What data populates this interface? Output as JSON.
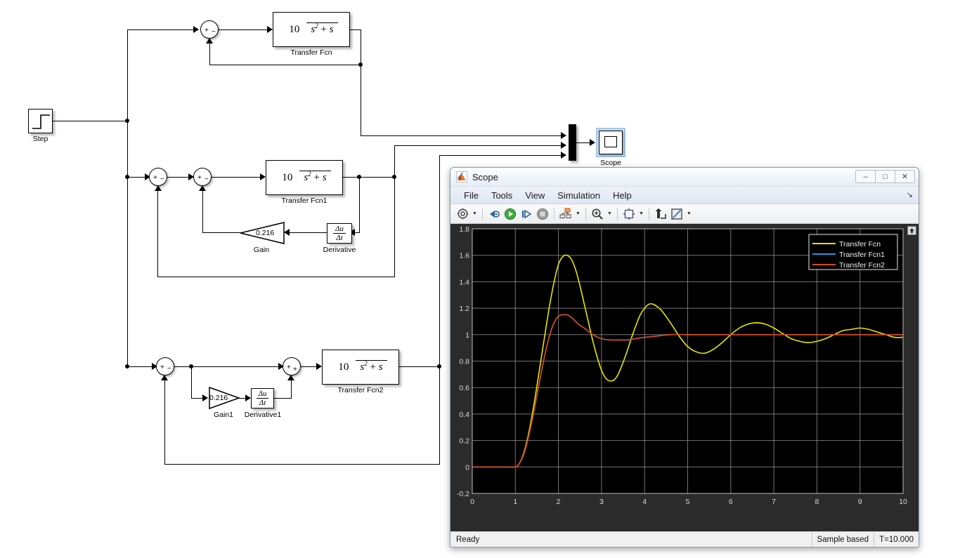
{
  "diagram": {
    "blocks": [
      {
        "id": "step",
        "type": "step",
        "label": "Step"
      },
      {
        "id": "sum_top",
        "type": "sum",
        "label": "",
        "signs": [
          "+",
          "-"
        ]
      },
      {
        "id": "tf0",
        "type": "transferfcn",
        "label": "Transfer Fcn",
        "numerator": "10",
        "denominator": "s^2 + s"
      },
      {
        "id": "sum_mid_a",
        "type": "sum",
        "label": "",
        "signs": [
          "+",
          "-"
        ]
      },
      {
        "id": "sum_mid_b",
        "type": "sum",
        "label": "",
        "signs": [
          "+",
          "-"
        ]
      },
      {
        "id": "tf1",
        "type": "transferfcn",
        "label": "Transfer Fcn1",
        "numerator": "10",
        "denominator": "s^2 + s"
      },
      {
        "id": "gain",
        "type": "gain",
        "label": "Gain",
        "value": "0.216"
      },
      {
        "id": "deriv",
        "type": "derivative",
        "label": "Derivative",
        "expr": "du/dt"
      },
      {
        "id": "sum_bot_a",
        "type": "sum",
        "label": "",
        "signs": [
          "+",
          "-"
        ]
      },
      {
        "id": "gain1",
        "type": "gain",
        "label": "Gain1",
        "value": "0.216"
      },
      {
        "id": "deriv1",
        "type": "derivative",
        "label": "Derivative1",
        "expr": "du/dt"
      },
      {
        "id": "sum_bot_b",
        "type": "sum",
        "label": "",
        "signs": [
          "+",
          "+"
        ]
      },
      {
        "id": "tf2",
        "type": "transferfcn",
        "label": "Transfer Fcn2",
        "numerator": "10",
        "denominator": "s^2 + s"
      },
      {
        "id": "mux",
        "type": "mux",
        "label": "",
        "inputs": 3
      },
      {
        "id": "scope",
        "type": "scope",
        "label": "Scope",
        "selected": true
      }
    ],
    "labels": {
      "step": "Step",
      "tf0": "Transfer Fcn",
      "tf1": "Transfer Fcn1",
      "tf2": "Transfer Fcn2",
      "gain": "Gain",
      "gain1": "Gain1",
      "deriv": "Derivative",
      "deriv1": "Derivative1",
      "scope": "Scope"
    },
    "values": {
      "gain": "0.216",
      "gain1": "0.216",
      "tf_num": "10",
      "tf_den_base": "s",
      "tf_den_exp": "2",
      "tf_den_tail": "+ s",
      "deriv_num": "Δu",
      "deriv_den": "Δt"
    }
  },
  "scope_window": {
    "title": "Scope",
    "icon": "matlab-icon",
    "window_buttons": [
      {
        "name": "minimize-button",
        "glyph": "–"
      },
      {
        "name": "maximize-button",
        "glyph": "□"
      },
      {
        "name": "close-button",
        "glyph": "✕"
      }
    ],
    "menu": [
      "File",
      "Tools",
      "View",
      "Simulation",
      "Help"
    ],
    "undock_glyph": "↘",
    "toolbar": [
      {
        "name": "configuration-properties-icon",
        "has_caret": true
      },
      {
        "name": "separator"
      },
      {
        "name": "run-back-to-start-icon",
        "has_caret": false
      },
      {
        "name": "run-icon",
        "has_caret": false
      },
      {
        "name": "step-forward-icon",
        "has_caret": false
      },
      {
        "name": "stop-icon",
        "has_caret": false
      },
      {
        "name": "separator"
      },
      {
        "name": "signal-selection-icon",
        "has_caret": true
      },
      {
        "name": "separator"
      },
      {
        "name": "zoom-in-icon",
        "has_caret": true
      },
      {
        "name": "separator"
      },
      {
        "name": "autoscale-icon",
        "has_caret": true
      },
      {
        "name": "separator"
      },
      {
        "name": "cursor-measurements-icon",
        "has_caret": false
      },
      {
        "name": "measurements-icon",
        "has_caret": true
      }
    ],
    "plot_overlay_button": {
      "name": "maximize-axes-button",
      "glyph": "⬆"
    },
    "statusbar": {
      "status": "Ready",
      "frame_mode": "Sample based",
      "time": "T=10.000"
    }
  },
  "chart_data": {
    "type": "line",
    "title": "",
    "xlabel": "",
    "ylabel": "",
    "xlim": [
      0,
      10
    ],
    "ylim": [
      -0.2,
      1.8
    ],
    "xticks": [
      0,
      1,
      2,
      3,
      4,
      5,
      6,
      7,
      8,
      9,
      10
    ],
    "yticks": [
      -0.2,
      0,
      0.2,
      0.4,
      0.6,
      0.8,
      1,
      1.2,
      1.4,
      1.6,
      1.8
    ],
    "xtick_labels": [
      "0",
      "1",
      "2",
      "3",
      "4",
      "5",
      "6",
      "7",
      "8",
      "9",
      "10"
    ],
    "ytick_labels": [
      "-0.2",
      "0",
      "0.2",
      "0.4",
      "0.6",
      "0.8",
      "1",
      "1.2",
      "1.4",
      "1.6",
      "1.8"
    ],
    "grid": true,
    "background": "#000000",
    "grid_color": "#9a9a9a",
    "legend_position": "top-right",
    "legend_background": "#000000",
    "series": [
      {
        "name": "Transfer Fcn",
        "color": "#e6e600",
        "x": [
          0,
          0.5,
          1,
          1.05,
          1.1,
          1.2,
          1.3,
          1.4,
          1.5,
          1.6,
          1.7,
          1.8,
          1.9,
          2.0,
          2.1,
          2.2,
          2.3,
          2.4,
          2.5,
          2.6,
          2.7,
          2.8,
          2.9,
          3.0,
          3.1,
          3.2,
          3.3,
          3.4,
          3.5,
          3.6,
          3.7,
          3.8,
          3.9,
          4.0,
          4.1,
          4.2,
          4.3,
          4.4,
          4.6,
          4.8,
          5.0,
          5.2,
          5.4,
          5.6,
          5.8,
          6.0,
          6.2,
          6.4,
          6.6,
          6.8,
          7.0,
          7.2,
          7.4,
          7.6,
          7.8,
          8.0,
          8.2,
          8.4,
          8.6,
          8.8,
          9.0,
          9.2,
          9.4,
          9.6,
          9.8,
          10.0
        ],
        "y": [
          0,
          0,
          0,
          0.01,
          0.03,
          0.11,
          0.24,
          0.41,
          0.61,
          0.82,
          1.03,
          1.23,
          1.4,
          1.53,
          1.59,
          1.6,
          1.57,
          1.49,
          1.37,
          1.23,
          1.09,
          0.95,
          0.83,
          0.73,
          0.67,
          0.65,
          0.66,
          0.71,
          0.79,
          0.88,
          0.98,
          1.07,
          1.15,
          1.2,
          1.23,
          1.23,
          1.21,
          1.18,
          1.09,
          0.99,
          0.91,
          0.87,
          0.86,
          0.89,
          0.94,
          1.0,
          1.05,
          1.08,
          1.09,
          1.08,
          1.05,
          1.01,
          0.97,
          0.95,
          0.94,
          0.95,
          0.97,
          1.0,
          1.03,
          1.04,
          1.05,
          1.04,
          1.02,
          1.0,
          0.98,
          0.98
        ]
      },
      {
        "name": "Transfer Fcn1",
        "color": "#2f8fe0",
        "x": [
          0,
          0.5,
          1,
          1.05,
          1.1,
          1.2,
          1.3,
          1.4,
          1.5,
          1.6,
          1.7,
          1.8,
          1.9,
          2.0,
          2.1,
          2.2,
          2.3,
          2.4,
          2.5,
          2.6,
          2.8,
          3.0,
          3.2,
          3.4,
          3.6,
          3.8,
          4.0,
          4.3,
          4.6,
          5.0,
          5.5,
          6.0,
          6.5,
          7.0,
          7.5,
          8.0,
          9.0,
          10.0
        ],
        "y": [
          0,
          0,
          0,
          0.01,
          0.03,
          0.1,
          0.22,
          0.37,
          0.54,
          0.71,
          0.87,
          1.0,
          1.09,
          1.14,
          1.15,
          1.15,
          1.13,
          1.1,
          1.07,
          1.05,
          1.0,
          0.97,
          0.96,
          0.96,
          0.96,
          0.97,
          0.98,
          0.99,
          1.0,
          1.0,
          1.0,
          1.0,
          1.0,
          1.0,
          1.0,
          1.0,
          1.0,
          1.0
        ]
      },
      {
        "name": "Transfer Fcn2",
        "color": "#d8491b",
        "x": [
          0,
          0.5,
          1,
          1.05,
          1.1,
          1.2,
          1.3,
          1.4,
          1.5,
          1.6,
          1.7,
          1.8,
          1.9,
          2.0,
          2.1,
          2.2,
          2.3,
          2.4,
          2.5,
          2.6,
          2.8,
          3.0,
          3.2,
          3.4,
          3.6,
          3.8,
          4.0,
          4.3,
          4.6,
          5.0,
          5.5,
          6.0,
          6.5,
          7.0,
          7.5,
          8.0,
          9.0,
          10.0
        ],
        "y": [
          0,
          0,
          0,
          0.01,
          0.03,
          0.1,
          0.22,
          0.37,
          0.54,
          0.71,
          0.87,
          1.0,
          1.09,
          1.14,
          1.15,
          1.15,
          1.13,
          1.1,
          1.07,
          1.05,
          1.0,
          0.97,
          0.96,
          0.96,
          0.96,
          0.97,
          0.98,
          0.99,
          1.0,
          1.0,
          1.0,
          1.0,
          1.0,
          1.0,
          1.0,
          1.0,
          1.0,
          1.0
        ]
      }
    ]
  }
}
